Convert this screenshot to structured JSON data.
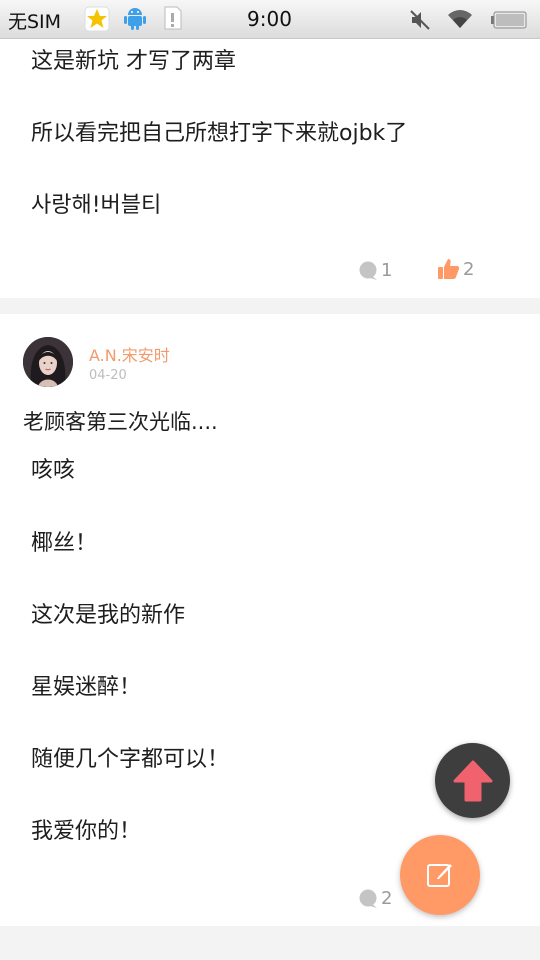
{
  "status_bar": {
    "carrier": "无SIM",
    "time": "9:00"
  },
  "posts": [
    {
      "paragraphs": [
        "这是新坑 才写了两章",
        "所以看完把自己所想打字下来就ojbk了",
        "사랑해!버블티"
      ],
      "comment_count": "1",
      "like_count": "2"
    },
    {
      "author": "A.N.宋安时",
      "date": "04-20",
      "title": "老顾客第三次光临....",
      "paragraphs": [
        "咳咳",
        "椰丝！",
        "这次是我的新作",
        "星娱迷醉！",
        "随便几个字都可以！",
        "我爱你的！"
      ],
      "comment_count": "2"
    }
  ],
  "colors": {
    "accent": "#ff9966",
    "author": "#f39a6b",
    "fab_dark": "#3e3e3e",
    "arrow": "#f0626e"
  },
  "icons": {
    "comment": "comment-icon",
    "like": "thumbs-up-icon",
    "back_to_top": "arrow-up-icon",
    "compose": "edit-icon"
  }
}
